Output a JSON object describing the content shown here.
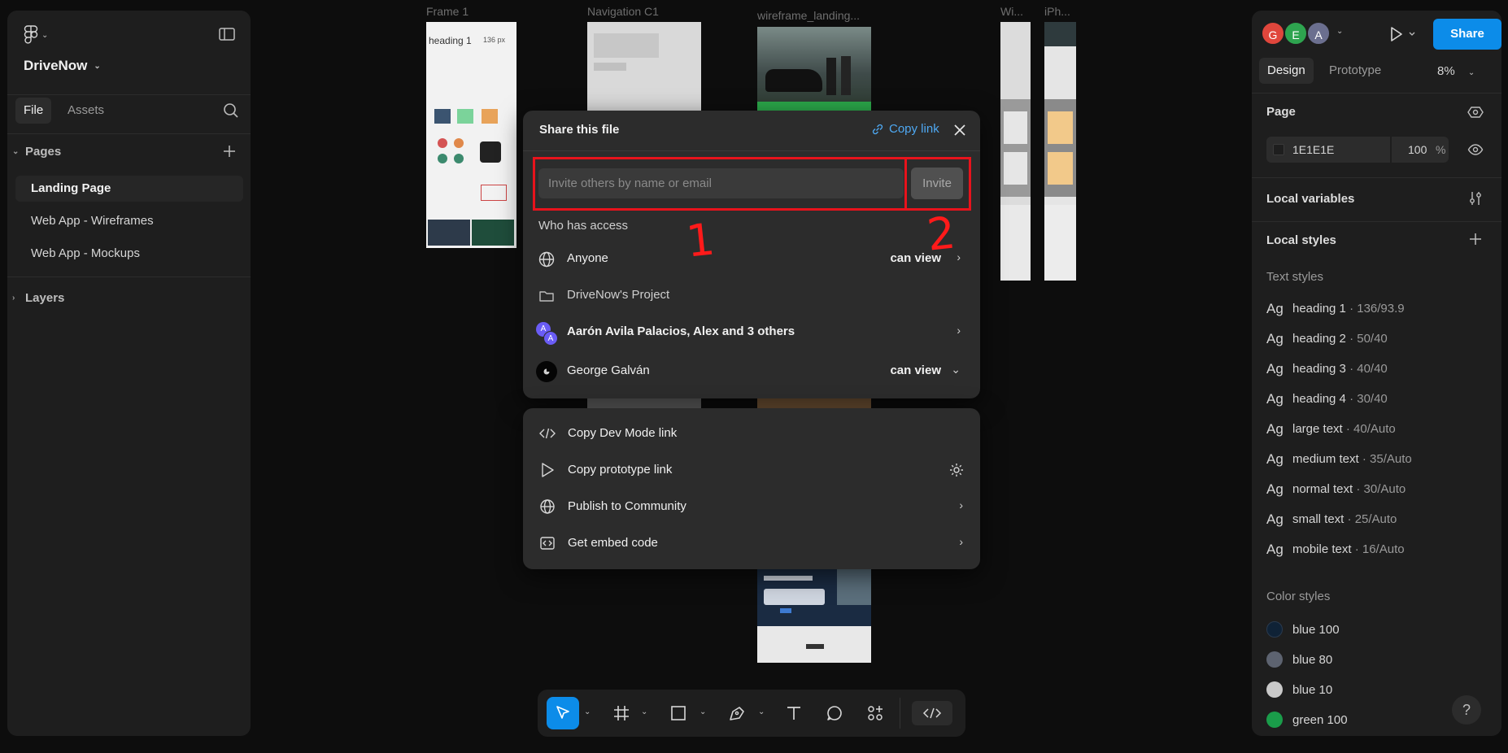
{
  "canvas": {
    "frames": [
      {
        "label": "Frame 1"
      },
      {
        "label": "Navigation C1"
      },
      {
        "label": "wireframe_landing..."
      },
      {
        "label": "Wi..."
      },
      {
        "label": "iPh..."
      }
    ],
    "frame1_heading": "heading 1",
    "frame1_size": "136 px"
  },
  "left_panel": {
    "project_name": "DriveNow",
    "tabs": [
      {
        "label": "File"
      },
      {
        "label": "Assets"
      }
    ],
    "pages_header": "Pages",
    "pages": [
      {
        "label": "Landing Page"
      },
      {
        "label": "Web App - Wireframes"
      },
      {
        "label": "Web App - Mockups"
      }
    ],
    "layers_header": "Layers"
  },
  "right_panel": {
    "avatars": [
      {
        "initial": "G",
        "color": "#e0463c"
      },
      {
        "initial": "E",
        "color": "#2ea44f"
      },
      {
        "initial": "A",
        "color": "#6b6f8f"
      }
    ],
    "share_label": "Share",
    "tabs": [
      {
        "label": "Design"
      },
      {
        "label": "Prototype"
      }
    ],
    "zoom": "8%",
    "page_header": "Page",
    "page_color": "1E1E1E",
    "page_opacity": "100",
    "percent_sign": "%",
    "local_variables": "Local variables",
    "local_styles": "Local styles",
    "text_styles_header": "Text styles",
    "text_styles": [
      {
        "ag": "Ag",
        "name": "heading 1",
        "meta": " · 136/93.9"
      },
      {
        "ag": "Ag",
        "name": "heading 2",
        "meta": " · 50/40"
      },
      {
        "ag": "Ag",
        "name": "heading 3",
        "meta": " · 40/40"
      },
      {
        "ag": "Ag",
        "name": "heading 4",
        "meta": " · 30/40"
      },
      {
        "ag": "Ag",
        "name": "large text",
        "meta": " · 40/Auto"
      },
      {
        "ag": "Ag",
        "name": "medium text",
        "meta": " · 35/Auto"
      },
      {
        "ag": "Ag",
        "name": "normal text",
        "meta": " · 30/Auto"
      },
      {
        "ag": "Ag",
        "name": "small text",
        "meta": " · 25/Auto"
      },
      {
        "ag": "Ag",
        "name": "mobile text",
        "meta": " · 16/Auto"
      }
    ],
    "color_styles_header": "Color styles",
    "color_styles": [
      {
        "name": "blue 100",
        "color": "#0f2236"
      },
      {
        "name": "blue 80",
        "color": "#5d6370"
      },
      {
        "name": "blue 10",
        "color": "#c9c9c9"
      },
      {
        "name": "green 100",
        "color": "#1a9c4a"
      }
    ],
    "help": "?"
  },
  "share_dialog": {
    "title": "Share this file",
    "copy_link": "Copy link",
    "invite_placeholder": "Invite others by name or email",
    "invite_label": "Invite",
    "who_has_access": "Who has access",
    "access": [
      {
        "name": "Anyone",
        "permission": "can view",
        "arrow": "›"
      },
      {
        "name": "DriveNow's Project"
      },
      {
        "name": "Aarón Avila Palacios, Alex and 3 others",
        "arrow": "›",
        "avatar_initials": [
          "A",
          "A"
        ]
      },
      {
        "name": "George Galván",
        "permission": "can view",
        "arrow": "⌄"
      }
    ],
    "annotations": [
      "1",
      "2"
    ],
    "accent": "#4ea8f2",
    "annotation_color": "#e8131c"
  },
  "share_menu": {
    "items": [
      {
        "label": "Copy Dev Mode link"
      },
      {
        "label": "Copy prototype link"
      },
      {
        "label": "Publish to Community",
        "arrow": "›"
      },
      {
        "label": "Get embed code",
        "arrow": "›"
      }
    ]
  }
}
